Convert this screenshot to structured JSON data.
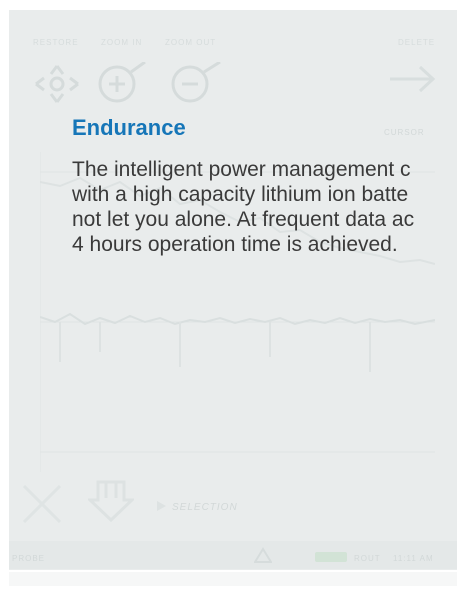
{
  "background_ui": {
    "topbar": {
      "labels": [
        "RESTORE",
        "ZOOM IN",
        "ZOOM OUT",
        "DELETE"
      ]
    },
    "right_label": "CURSOR",
    "selection_label": "SELECTION",
    "status": {
      "left_text": "PROBE",
      "battery_text": "ROUT",
      "clock_text": "11:11 AM"
    }
  },
  "content": {
    "heading": "Endurance",
    "body_lines": [
      "The intelligent power management c",
      "with a high capacity lithium ion batte",
      "not let you alone. At frequent data ac",
      "4 hours operation time is achieved."
    ]
  },
  "colors": {
    "heading": "#1676b8",
    "body": "#3a3a3a",
    "screen_bg": "#e9ecec"
  }
}
